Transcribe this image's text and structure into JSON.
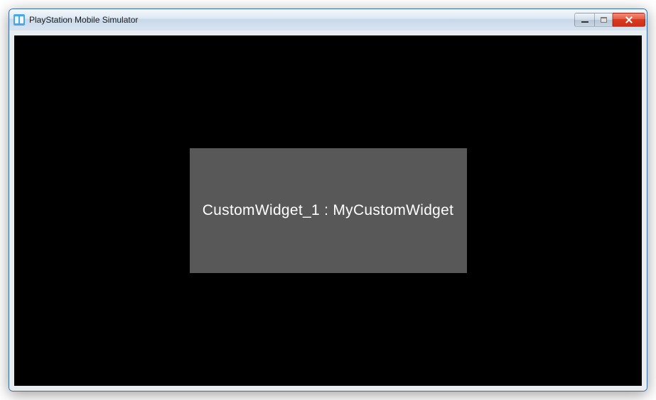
{
  "window": {
    "title": "PlayStation Mobile Simulator"
  },
  "content": {
    "widget_label": "CustomWidget_1 : MyCustomWidget"
  }
}
